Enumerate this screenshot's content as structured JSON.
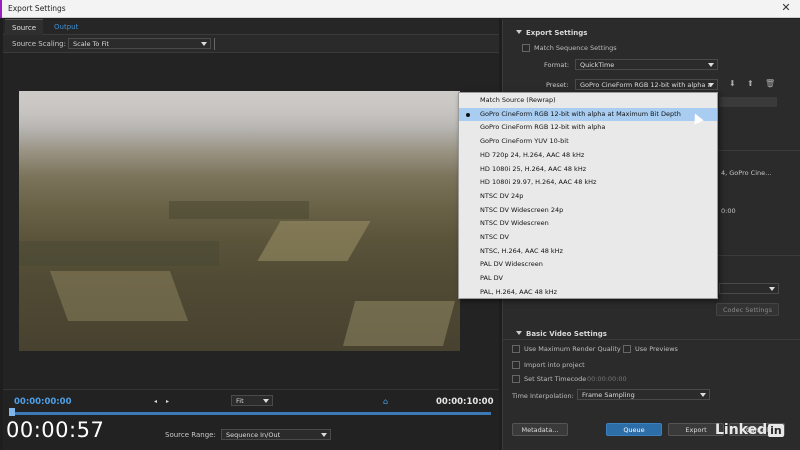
{
  "window": {
    "title": "Export Settings"
  },
  "tabs": {
    "source": "Source",
    "output": "Output"
  },
  "scaling": {
    "label": "Source Scaling:",
    "value": "Scale To Fit"
  },
  "playback": {
    "timecode_in": "00:00:00:00",
    "timecode_out": "00:00:10:00",
    "fit_value": "Fit",
    "source_range_label": "Source Range:",
    "source_range_value": "Sequence In/Out",
    "progress_fraction": 0.0
  },
  "overlay_timer": "00:00:57",
  "export_settings": {
    "header": "Export Settings",
    "match_sequence": "Match Sequence Settings",
    "format_label": "Format:",
    "format_value": "QuickTime",
    "preset_label": "Preset:",
    "preset_value": "GoPro CineForm RGB 12-bit with alpha a",
    "summary_fragment": "4, GoPro Cine...",
    "time_fragment": "0:00",
    "codec_settings": "Codec Settings",
    "basic_video_settings": "Basic Video Settings"
  },
  "preset_menu": {
    "items": [
      "Match Source (Rewrap)",
      "GoPro CineForm RGB 12-bit with alpha at Maximum Bit Depth",
      "GoPro CineForm RGB 12-bit with alpha",
      "GoPro CineForm YUV 10-bit",
      "HD 720p 24, H.264, AAC 48 kHz",
      "HD 1080i 25, H.264, AAC 48 kHz",
      "HD 1080i 29.97, H.264, AAC 48 kHz",
      "NTSC DV 24p",
      "NTSC DV Widescreen 24p",
      "NTSC DV Widescreen",
      "NTSC DV",
      "NTSC, H.264, AAC 48 kHz",
      "PAL DV Widescreen",
      "PAL DV",
      "PAL, H.264, AAC 48 kHz"
    ],
    "selected_index": 1
  },
  "bottom_options": {
    "max_render_quality": "Use Maximum Render Quality",
    "use_previews": "Use Previews",
    "import_into_project": "Import into project",
    "set_start_timecode": "Set Start Timecode",
    "start_timecode_value": "00:00:00:00",
    "time_interpolation_label": "Time Interpolation:",
    "time_interpolation_value": "Frame Sampling"
  },
  "buttons": {
    "metadata": "Metadata...",
    "queue": "Queue",
    "export": "Export",
    "cancel": "Cancel"
  },
  "watermark": {
    "text": "Linked",
    "suffix": "in"
  }
}
